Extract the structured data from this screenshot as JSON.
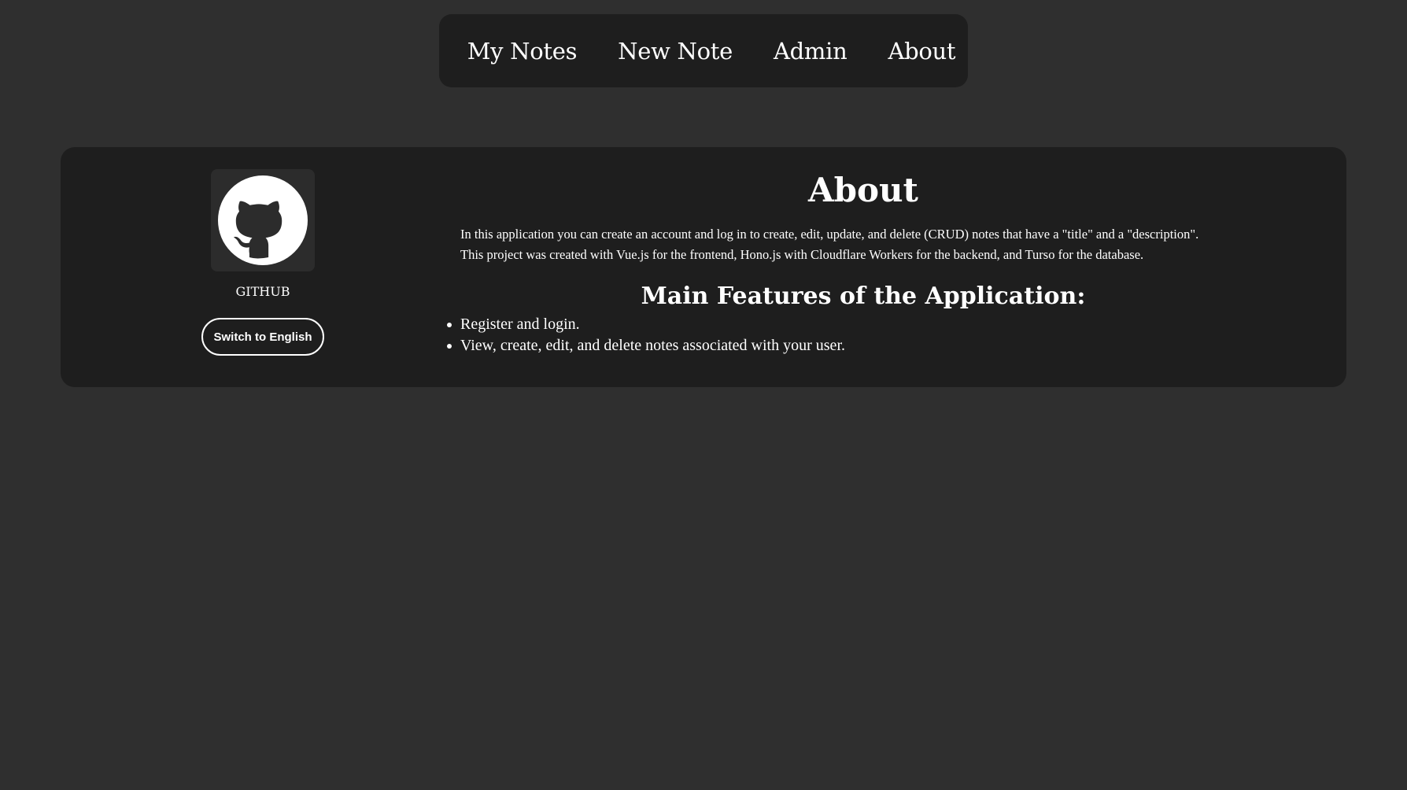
{
  "nav": {
    "items": [
      {
        "label": "My Notes"
      },
      {
        "label": "New Note"
      },
      {
        "label": "Admin"
      },
      {
        "label": "About"
      }
    ]
  },
  "sidebar": {
    "github_icon": "github-icon",
    "github_label": "GITHUB",
    "lang_button": "Switch to English"
  },
  "about": {
    "title": "About",
    "description_line1": "In this application you can create an account and log in to create, edit, update, and delete (CRUD) notes that have a \"title\" and a \"description\".",
    "description_line2": "This project was created with Vue.js for the frontend, Hono.js with Cloudflare Workers for the backend, and Turso for the database.",
    "features_title": "Main Features of the Application:",
    "features": [
      "Register and login.",
      "View, create, edit, and delete notes associated with your user."
    ]
  },
  "colors": {
    "background": "#2f2f2f",
    "panel": "#1e1e1e",
    "text": "#ffffff"
  }
}
